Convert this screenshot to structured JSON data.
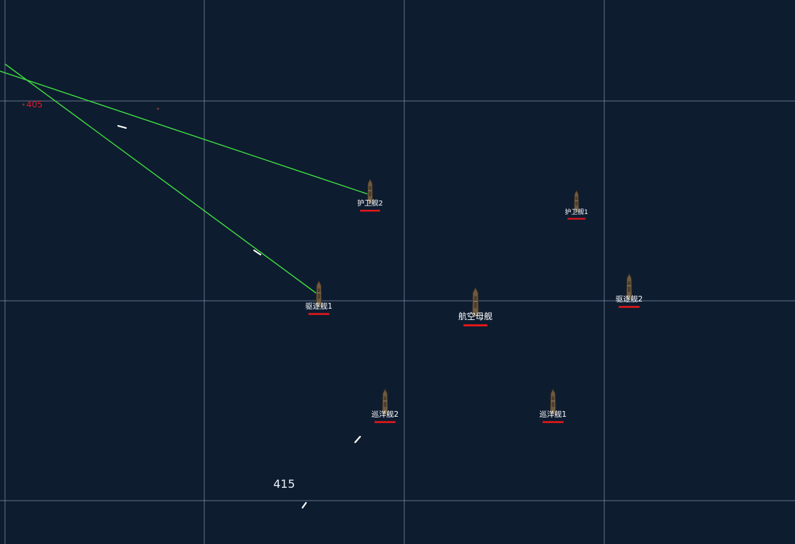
{
  "map": {
    "background": "#0e1c30",
    "grid_color": "#7d8fa6",
    "track_color": "#3fe03f",
    "health_color": "#e01818"
  },
  "ships": [
    {
      "id": "frigate-2",
      "label": "护卫舰2",
      "icon": "ship-icon"
    },
    {
      "id": "frigate-1",
      "label": "护卫舰1",
      "icon": "ship-icon"
    },
    {
      "id": "destroyer-1",
      "label": "驱逐舰1",
      "icon": "ship-icon"
    },
    {
      "id": "aircraft-carrier",
      "label": "航空母舰",
      "icon": "ship-icon"
    },
    {
      "id": "destroyer-2",
      "label": "驱逐舰2",
      "icon": "ship-icon"
    },
    {
      "id": "cruiser-2",
      "label": "巡洋舰2",
      "icon": "ship-icon"
    },
    {
      "id": "cruiser-1",
      "label": "巡洋舰1",
      "icon": "ship-icon"
    }
  ],
  "markers": [
    {
      "id": "track-405",
      "label": "405",
      "color": "#d8202a"
    },
    {
      "id": "track-415",
      "label": "415",
      "color": "#e8eef5"
    }
  ]
}
